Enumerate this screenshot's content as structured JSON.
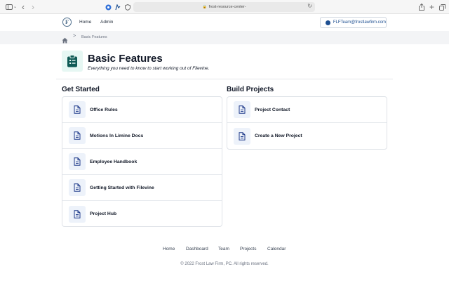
{
  "browser": {
    "url": "frost-resource-center-",
    "icons": [
      "sidebar-icon",
      "chevron-down-icon",
      "back-icon",
      "forward-icon",
      "shield-icon",
      "extension-icon",
      "privacy-icon",
      "lock-icon",
      "reload-icon",
      "share-icon",
      "new-tab-icon",
      "tabs-overview-icon"
    ]
  },
  "header": {
    "logo_letter": "F",
    "nav": [
      "Home",
      "Admin"
    ],
    "user_email": "FLFTeam@frostlawfirm.com"
  },
  "breadcrumb": {
    "separator": ">",
    "current": "Basic Features"
  },
  "page": {
    "title": "Basic Features",
    "subtitle": "Everything you need to know to start working out of Filevine."
  },
  "sections": {
    "get_started": {
      "title": "Get Started",
      "items": [
        "Office Rules",
        "Motions In Limine Docs",
        "Employee Handbook",
        "Getting Started with Filevine",
        "Project Hub"
      ]
    },
    "build_projects": {
      "title": "Build Projects",
      "items": [
        "Project Contact",
        "Create a New Project"
      ]
    }
  },
  "footer": {
    "links": [
      "Home",
      "Dashboard",
      "Team",
      "Projects",
      "Calendar"
    ],
    "copyright": "© 2022 Frost Law Firm, PC. All rights reserved."
  },
  "colors": {
    "accent": "#1d4f91",
    "doc_icon": "#1e3a8a",
    "title_icon": "#0f5a55",
    "title_icon_bg": "#e6f7f3"
  }
}
